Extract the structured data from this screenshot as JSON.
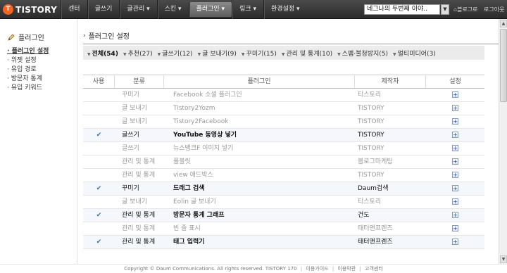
{
  "topbar": {
    "logo_mark": "T",
    "logo_text": "TISTORY",
    "nav": [
      "센터",
      "글쓰기",
      "글관리 ▾",
      "스킨 ▾",
      "플러그인 ▾",
      "링크 ▾",
      "환경설정 ▾"
    ],
    "active_nav_index": 4,
    "blog_select_value": "네그나의 두번째 이야..",
    "blog_link": "블로그로",
    "logout": "로그아웃"
  },
  "sidebar": {
    "title": "플러그인",
    "items": [
      "플러그인 설정",
      "위젯 설정",
      "유입 경로",
      "방문자 통계",
      "유입 키워드"
    ],
    "active_index": 0
  },
  "main": {
    "title": "플러그인 설정",
    "filters": [
      "전체(54)",
      "추천(27)",
      "글쓰기(12)",
      "글 보내기(9)",
      "꾸미기(15)",
      "관리 및 통계(10)",
      "스팸·불청방지(5)",
      "멀티미디어(3)"
    ],
    "active_filter_index": 0,
    "columns": [
      "사용",
      "분류",
      "플러그인",
      "제작자",
      "설정"
    ],
    "rows": [
      {
        "used": "",
        "category": "꾸미기",
        "name": "Facebook 소셜 플러그인",
        "maker": "티스토리",
        "setting": "+"
      },
      {
        "used": "",
        "category": "글 보내기",
        "name": "Tistory2Yozm",
        "maker": "TISTORY",
        "setting": "+"
      },
      {
        "used": "",
        "category": "글 보내기",
        "name": "Tistory2Facebook",
        "maker": "TISTORY",
        "setting": "+"
      },
      {
        "used": "✔",
        "category": "글쓰기",
        "name": "YouTube 동영상 넣기",
        "maker": "TISTORY",
        "setting": "+"
      },
      {
        "used": "",
        "category": "글쓰기",
        "name": "뉴스뱅크F 이미지 넣기",
        "maker": "TISTORY",
        "setting": "+"
      },
      {
        "used": "",
        "category": "관리 및 통계",
        "name": "폴블릿",
        "maker": "블로그마케팅",
        "setting": "+"
      },
      {
        "used": "",
        "category": "관리 및 통계",
        "name": "view 애드박스",
        "maker": "TISTORY",
        "setting": "+"
      },
      {
        "used": "✔",
        "category": "꾸미기",
        "name": "드래그 검색",
        "maker": "Daum검색",
        "setting": "+"
      },
      {
        "used": "",
        "category": "글 보내기",
        "name": "Eolin 글 보내기",
        "maker": "티스토리",
        "setting": "+"
      },
      {
        "used": "✔",
        "category": "관리 및 통계",
        "name": "방문자 통계 그래프",
        "maker": "건도",
        "setting": "+"
      },
      {
        "used": "",
        "category": "관리 및 통계",
        "name": "빈 즐 표시",
        "maker": "태터앤프렌즈",
        "setting": "+"
      },
      {
        "used": "✔",
        "category": "관리 및 통계",
        "name": "태그 입력기",
        "maker": "태터앤프렌즈",
        "setting": "+"
      }
    ]
  },
  "footer": {
    "copyright": "Copyright © Daum Communications. All rights reserved. TISTORY 170",
    "links": [
      "이용가이드",
      "이용약관",
      "고객센터"
    ]
  }
}
